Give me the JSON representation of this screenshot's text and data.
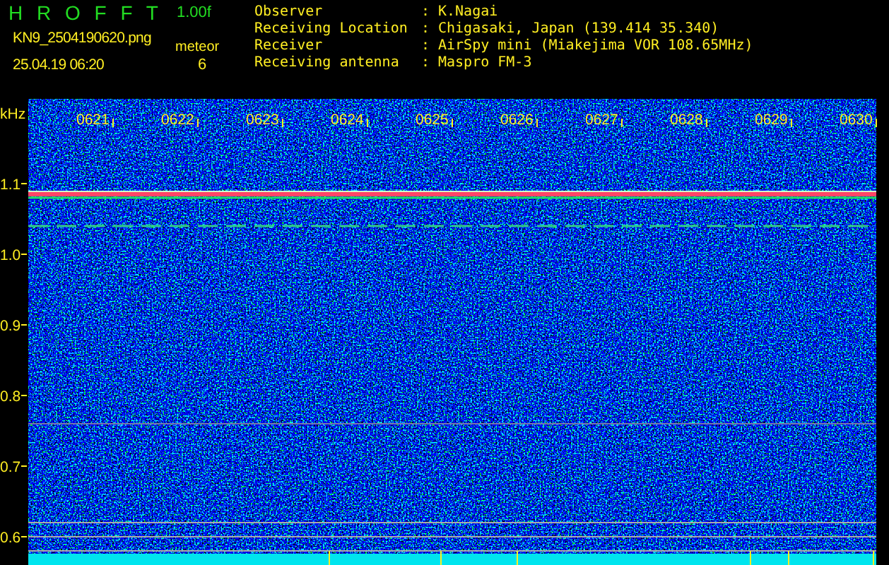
{
  "header": {
    "app_name": "H R O F F T",
    "version": "1.00f",
    "file_name": "KN9_2504190620.png",
    "timestamp": "25.04.19 06:20",
    "mode_label": "meteor",
    "count": "6",
    "info": [
      {
        "label": "Observer",
        "separator": ":",
        "value": "K.Nagai"
      },
      {
        "label": "Receiving Location",
        "separator": ":",
        "value": "Chigasaki, Japan (139.414 35.340)"
      },
      {
        "label": "Receiver",
        "separator": ":",
        "value": "AirSpy mini (Miakejima VOR 108.65MHz)"
      },
      {
        "label": "Receiving antenna",
        "separator": ":",
        "value": "Maspro FM-3"
      }
    ]
  },
  "spectrogram": {
    "unit": "kHz",
    "y_labels": [
      "1.1",
      "1.0",
      "0.9",
      "0.8",
      "0.7",
      "0.6"
    ],
    "time_labels": [
      "0621",
      "0622",
      "0623",
      "0624",
      "0625",
      "0626",
      "0627",
      "0628",
      "0629",
      "0630"
    ]
  }
}
